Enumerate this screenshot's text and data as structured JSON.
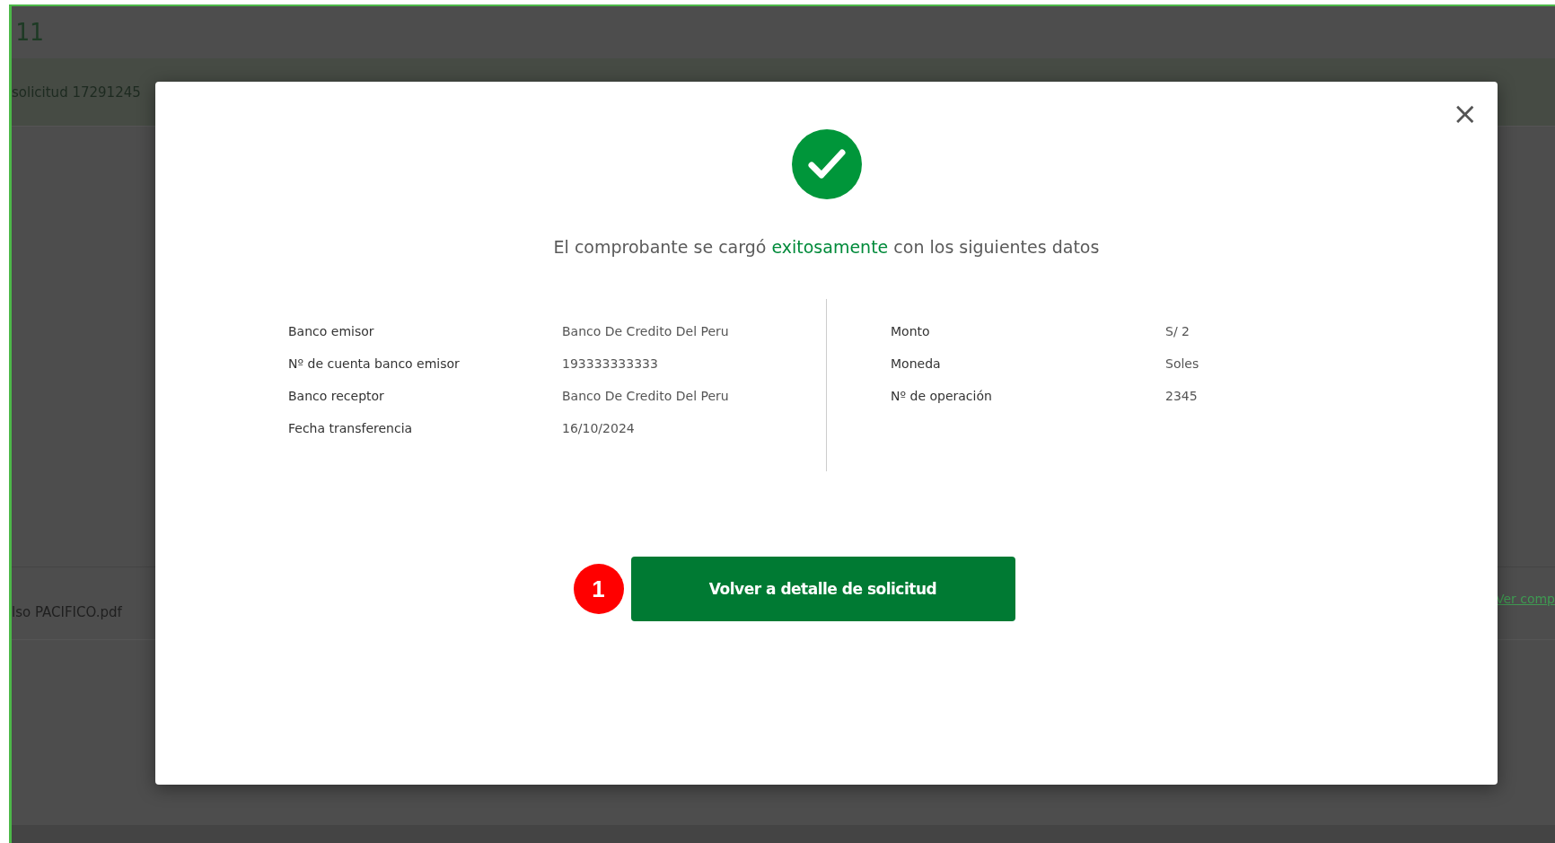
{
  "background": {
    "header_number": "11",
    "request_label": "solicitud 17291245",
    "file_name": "lso PACIFICO.pdf",
    "view_link": "Ver comp"
  },
  "modal": {
    "close": "×",
    "message": "El comprobante se cargó **exitosamente** con los siguientes datos",
    "left_details": [
      {
        "label": "Banco emisor",
        "value": "Banco De Credito Del Peru"
      },
      {
        "label": "Nº de cuenta banco emisor",
        "value": "193333333333"
      },
      {
        "label": "Banco receptor",
        "value": "Banco De Credito Del Peru"
      },
      {
        "label": "Fecha transferencia",
        "value": "16/10/2024"
      }
    ],
    "right_details": [
      {
        "label": "Monto",
        "value": "S/ 2"
      },
      {
        "label": "Moneda",
        "value": "Soles"
      },
      {
        "label": "Nº de operación",
        "value": "2345"
      }
    ],
    "step_badge": "1",
    "button": "Volver a detalle de solicitud"
  }
}
